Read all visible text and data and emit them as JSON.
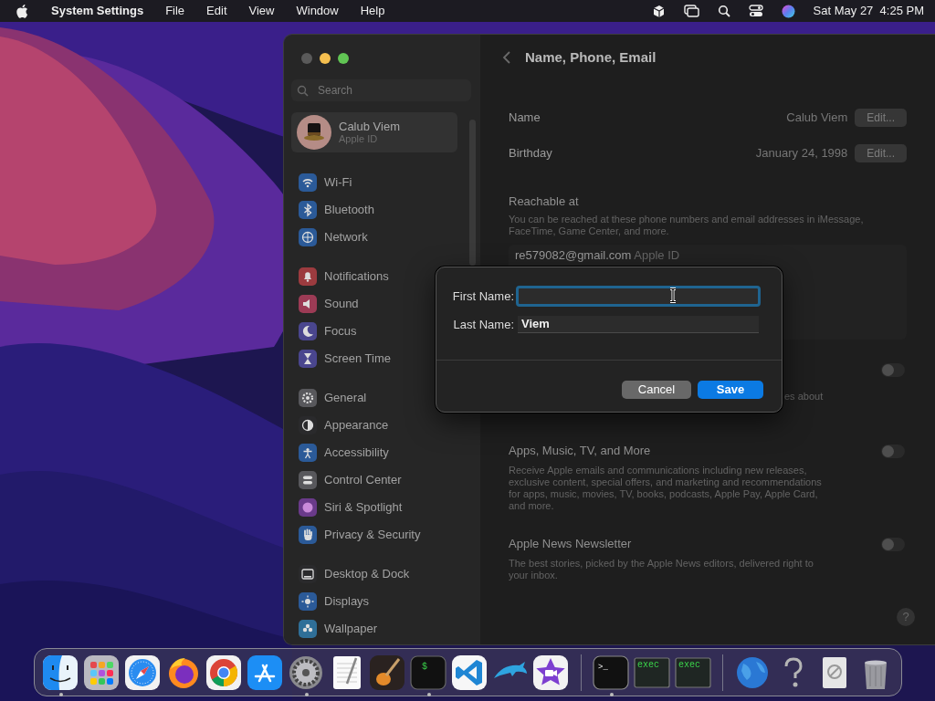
{
  "menu_bar": {
    "app_name": "System Settings",
    "menus": [
      "File",
      "Edit",
      "View",
      "Window",
      "Help"
    ],
    "clock": "Sat May 27  4:25 PM"
  },
  "settings_window": {
    "search": {
      "placeholder": "Search"
    },
    "account": {
      "name": "Calub Viem",
      "subtitle": "Apple ID",
      "selected": true
    },
    "sidebar_groups": [
      [
        {
          "label": "Wi-Fi",
          "kind": "wifi",
          "color": "#2b5a98",
          "selected": false
        },
        {
          "label": "Bluetooth",
          "kind": "bluetooth",
          "color": "#2b5a98",
          "selected": false
        },
        {
          "label": "Network",
          "kind": "globe",
          "color": "#2b5a98",
          "selected": false
        }
      ],
      [
        {
          "label": "Notifications",
          "kind": "bell",
          "color": "#9c3b3f",
          "selected": false
        },
        {
          "label": "Sound",
          "kind": "speaker",
          "color": "#9c3b55",
          "selected": false
        },
        {
          "label": "Focus",
          "kind": "moon",
          "color": "#4a468e",
          "selected": false
        },
        {
          "label": "Screen Time",
          "kind": "hourglass",
          "color": "#4a468e",
          "selected": false
        }
      ],
      [
        {
          "label": "General",
          "kind": "gear",
          "color": "#58585c",
          "selected": false
        },
        {
          "label": "Appearance",
          "kind": "contrast",
          "color": "#2a2a2c",
          "selected": false
        },
        {
          "label": "Accessibility",
          "kind": "person",
          "color": "#2b5a98",
          "selected": false
        },
        {
          "label": "Control Center",
          "kind": "switches",
          "color": "#58585c",
          "selected": false
        },
        {
          "label": "Siri & Spotlight",
          "kind": "orb",
          "color": "#6a3a8a",
          "selected": false
        },
        {
          "label": "Privacy & Security",
          "kind": "hand",
          "color": "#2b5a98",
          "selected": false
        }
      ],
      [
        {
          "label": "Desktop & Dock",
          "kind": "dock",
          "color": "#2a2a2c",
          "selected": false
        },
        {
          "label": "Displays",
          "kind": "sun",
          "color": "#2b5a98",
          "selected": false
        },
        {
          "label": "Wallpaper",
          "kind": "flower",
          "color": "#2f6f98",
          "selected": false
        }
      ]
    ],
    "page_title": "Name, Phone, Email",
    "help_button": "?",
    "rows": [
      {
        "label": "Name",
        "value": "Calub Viem",
        "button": "Edit..."
      },
      {
        "label": "Birthday",
        "value": "January 24, 1998",
        "button": "Edit..."
      }
    ],
    "reachable": {
      "title": "Reachable at",
      "description": "You can be reached at these phone numbers and email addresses in iMessage, FaceTime, Game Center, and more.",
      "entries": [
        {
          "address": "re579082@gmail.com",
          "tag": "Apple ID"
        }
      ]
    },
    "subscriptions": [
      {
        "kind": "covered",
        "description": "es about",
        "on": false
      },
      {
        "kind": "full",
        "title": "Apps, Music, TV, and More",
        "description": "Receive Apple emails and communications including new releases, exclusive content, special offers, and marketing and recommendations for apps, music, movies, TV, books, podcasts, Apple Pay, Apple Card, and more.",
        "on": false
      },
      {
        "kind": "full",
        "title": "Apple News Newsletter",
        "description": "The best stories, picked by the Apple News editors, delivered right to your inbox.",
        "on": false
      }
    ]
  },
  "dialog": {
    "fields": [
      {
        "label": "First Name:",
        "focused": true
      },
      {
        "label": "Last Name:",
        "value": "Viem",
        "focused": false
      }
    ],
    "buttons": [
      {
        "label": "Cancel",
        "kind": "secondary"
      },
      {
        "label": "Save",
        "kind": "default"
      }
    ]
  },
  "dock": {
    "sections": [
      [
        {
          "kind": "finder",
          "running": true
        },
        {
          "kind": "launchpad",
          "running": false
        },
        {
          "kind": "safari",
          "running": false
        },
        {
          "kind": "firefox",
          "running": false
        },
        {
          "kind": "chrome",
          "running": false
        },
        {
          "kind": "appstore",
          "running": false
        },
        {
          "kind": "settings",
          "running": true
        },
        {
          "kind": "textedit",
          "running": false
        },
        {
          "kind": "garageband",
          "running": false
        },
        {
          "kind": "terminal",
          "caption": "$",
          "running": true
        },
        {
          "kind": "vscode",
          "running": false
        },
        {
          "kind": "dolphin",
          "running": false
        },
        {
          "kind": "imovie",
          "running": false
        }
      ],
      [
        {
          "kind": "terminal2",
          "caption": ">_",
          "running": true
        },
        {
          "kind": "console",
          "caption": "exec",
          "running": false
        },
        {
          "kind": "console",
          "caption": "exec",
          "running": false
        }
      ],
      [
        {
          "kind": "globe",
          "running": false
        },
        {
          "kind": "help",
          "running": false
        },
        {
          "kind": "document",
          "running": false
        },
        {
          "kind": "trash",
          "running": false
        }
      ]
    ]
  }
}
